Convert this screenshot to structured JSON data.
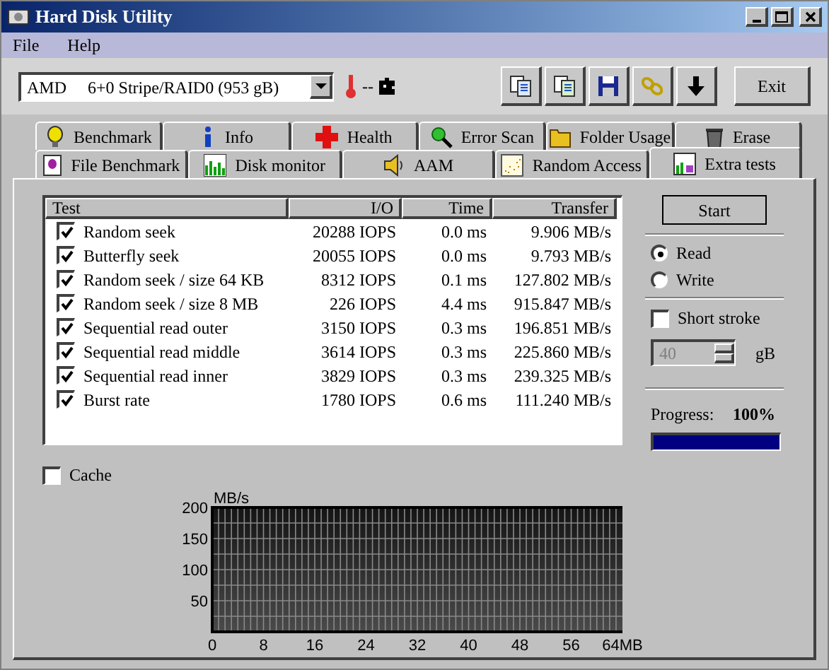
{
  "window": {
    "title": "Hard Disk Utility"
  },
  "menu": [
    "File",
    "Help"
  ],
  "toolbar": {
    "drive": "AMD     6+0 Stripe/RAID0 (953 gB)",
    "temperature": "--",
    "exit": "Exit"
  },
  "tabs_back": [
    {
      "label": "Benchmark",
      "selected": false
    },
    {
      "label": "Info",
      "selected": false
    },
    {
      "label": "Health",
      "selected": false
    },
    {
      "label": "Error Scan",
      "selected": false
    },
    {
      "label": "Folder Usage",
      "selected": false
    },
    {
      "label": "Erase",
      "selected": false
    }
  ],
  "tabs_front": [
    {
      "label": "File Benchmark",
      "selected": false
    },
    {
      "label": "Disk monitor",
      "selected": false
    },
    {
      "label": "AAM",
      "selected": false
    },
    {
      "label": "Random Access",
      "selected": false
    },
    {
      "label": "Extra tests",
      "selected": true
    }
  ],
  "table": {
    "columns": [
      "Test",
      "I/O",
      "Time",
      "Transfer"
    ],
    "rows": [
      {
        "test": "Random seek",
        "checked": true,
        "io": "20288 IOPS",
        "time": "0.0 ms",
        "transfer": "9.906 MB/s"
      },
      {
        "test": "Butterfly seek",
        "checked": true,
        "io": "20055 IOPS",
        "time": "0.0 ms",
        "transfer": "9.793 MB/s"
      },
      {
        "test": "Random seek / size 64 KB",
        "checked": true,
        "io": "8312 IOPS",
        "time": "0.1 ms",
        "transfer": "127.802 MB/s"
      },
      {
        "test": "Random seek / size 8 MB",
        "checked": true,
        "io": "226 IOPS",
        "time": "4.4 ms",
        "transfer": "915.847 MB/s"
      },
      {
        "test": "Sequential read outer",
        "checked": true,
        "io": "3150 IOPS",
        "time": "0.3 ms",
        "transfer": "196.851 MB/s"
      },
      {
        "test": "Sequential read middle",
        "checked": true,
        "io": "3614 IOPS",
        "time": "0.3 ms",
        "transfer": "225.860 MB/s"
      },
      {
        "test": "Sequential read inner",
        "checked": true,
        "io": "3829 IOPS",
        "time": "0.3 ms",
        "transfer": "239.325 MB/s"
      },
      {
        "test": "Burst rate",
        "checked": true,
        "io": "1780 IOPS",
        "time": "0.6 ms",
        "transfer": "111.240 MB/s"
      }
    ]
  },
  "controls": {
    "start": "Start",
    "modes": [
      {
        "label": "Read",
        "selected": true
      },
      {
        "label": "Write",
        "selected": false
      }
    ],
    "short_stroke": {
      "label": "Short stroke",
      "checked": false
    },
    "stroke_size": {
      "value": "40",
      "unit": "gB",
      "disabled": true
    },
    "progress": {
      "label": "Progress:",
      "value": "100%",
      "level": 1
    }
  },
  "cache": {
    "label": "Cache",
    "checked": false
  },
  "chart": {
    "chart_data": {
      "type": "line",
      "ylabel": "MB/s",
      "grid": true,
      "xlim": [
        0,
        64
      ],
      "ylim": [
        0,
        200
      ],
      "xticks": [
        0,
        8,
        16,
        24,
        32,
        40,
        48,
        56,
        {
          "value": 64,
          "label": "64MB"
        }
      ],
      "yticks": [
        50,
        100,
        150,
        200
      ]
    }
  }
}
